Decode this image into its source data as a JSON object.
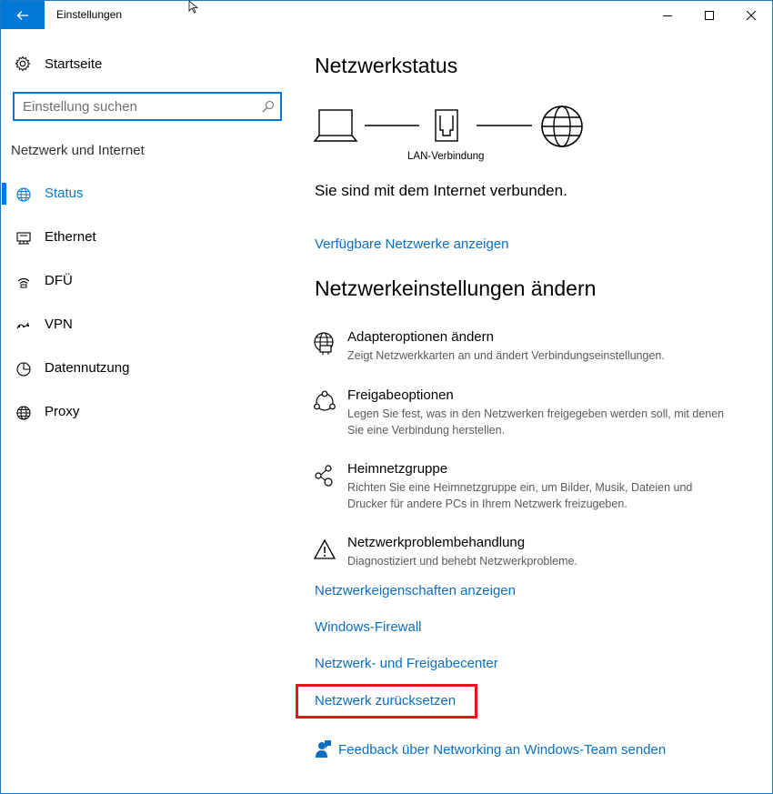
{
  "window": {
    "title": "Einstellungen"
  },
  "sidebar": {
    "home_label": "Startseite",
    "search_placeholder": "Einstellung suchen",
    "search_value": "",
    "section_title": "Netzwerk und Internet",
    "items": [
      {
        "label": "Status",
        "icon": "globe-status-icon",
        "active": true
      },
      {
        "label": "Ethernet",
        "icon": "ethernet-icon",
        "active": false
      },
      {
        "label": "DFÜ",
        "icon": "dialup-icon",
        "active": false
      },
      {
        "label": "VPN",
        "icon": "vpn-icon",
        "active": false
      },
      {
        "label": "Datennutzung",
        "icon": "data-usage-icon",
        "active": false
      },
      {
        "label": "Proxy",
        "icon": "globe-proxy-icon",
        "active": false
      }
    ]
  },
  "main": {
    "status_heading": "Netzwerkstatus",
    "connection_label": "LAN-Verbindung",
    "connected_text": "Sie sind mit dem Internet verbunden.",
    "show_networks_link": "Verfügbare Netzwerke anzeigen",
    "change_heading": "Netzwerkeinstellungen ändern",
    "settings": [
      {
        "title": "Adapteroptionen ändern",
        "description": "Zeigt Netzwerkkarten an und ändert Verbindungseinstellungen.",
        "icon": "adapter-globe-icon"
      },
      {
        "title": "Freigabeoptionen",
        "description": "Legen Sie fest, was in den Netzwerken freigegeben werden soll, mit denen Sie eine Verbindung herstellen.",
        "icon": "sharing-icon"
      },
      {
        "title": "Heimnetzgruppe",
        "description": "Richten Sie eine Heimnetzgruppe ein, um Bilder, Musik, Dateien und Drucker für andere PCs in Ihrem Netzwerk freizugeben.",
        "icon": "homegroup-icon"
      },
      {
        "title": "Netzwerkproblembehandlung",
        "description": "Diagnostiziert und behebt Netzwerkprobleme.",
        "icon": "warning-icon"
      }
    ],
    "links": [
      "Netzwerkeigenschaften anzeigen",
      "Windows-Firewall",
      "Netzwerk- und Freigabecenter",
      "Netzwerk zurücksetzen"
    ],
    "feedback_link": "Feedback über Networking an Windows-Team senden"
  },
  "colors": {
    "accent": "#0078d7",
    "link": "#0a6fc2",
    "highlight": "#e4181d"
  }
}
